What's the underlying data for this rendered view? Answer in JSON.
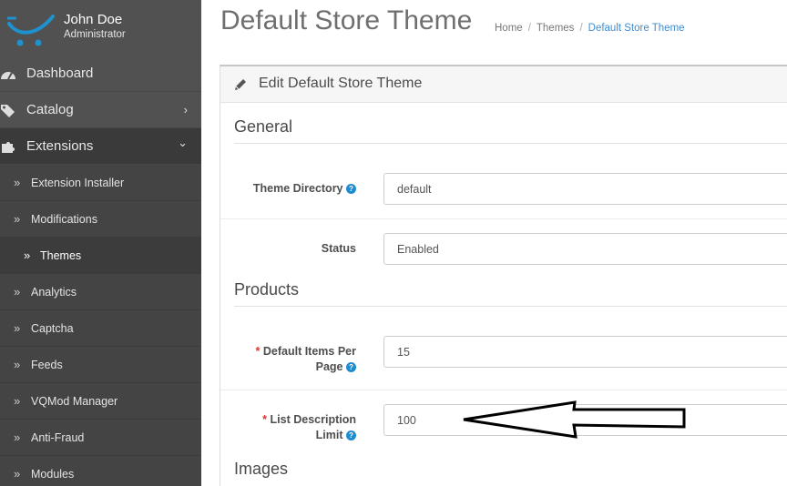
{
  "user": {
    "name": "John Doe",
    "role": "Administrator"
  },
  "nav": {
    "dashboard": "Dashboard",
    "catalog": "Catalog",
    "extensions": "Extensions",
    "chevron_right": "›",
    "chevron_down": "⌄",
    "sub_marker": "»",
    "sub_items": [
      "Extension Installer",
      "Modifications",
      "Themes",
      "Analytics",
      "Captcha",
      "Feeds",
      "VQMod Manager",
      "Anti-Fraud",
      "Modules"
    ],
    "active_sub": "Themes"
  },
  "page": {
    "title": "Default Store Theme"
  },
  "breadcrumb": {
    "items": [
      "Home",
      "Themes",
      "Default Store Theme"
    ],
    "separator": "/"
  },
  "panel": {
    "title": "Edit Default Store Theme"
  },
  "sections": {
    "general": "General",
    "products": "Products",
    "images": "Images"
  },
  "fields": {
    "theme_directory": {
      "label": "Theme Directory",
      "value": "default"
    },
    "status": {
      "label": "Status",
      "value": "Enabled"
    },
    "items_per_page": {
      "required": "*",
      "label": "Default Items Per Page",
      "value": "15"
    },
    "list_description_limit": {
      "required": "*",
      "label": "List Description Limit",
      "value": "100"
    }
  },
  "help_glyph": "?",
  "icons": [
    "opencart-logo",
    "dashboard-icon",
    "tag-icon",
    "puzzle-icon",
    "pencil-icon",
    "question-circle-icon",
    "arrow-annotation"
  ],
  "colors": {
    "sidebar": "#515151",
    "accent": "#1f8bd0",
    "link": "#3e8ed3",
    "required": "#d9352e"
  }
}
